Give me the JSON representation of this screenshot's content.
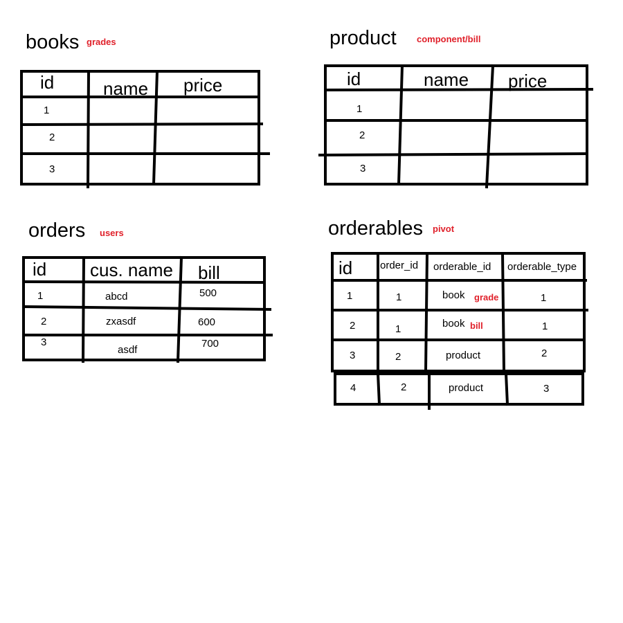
{
  "books": {
    "title": "books",
    "note": "grades",
    "headers": [
      "id",
      "name",
      "price"
    ],
    "rows": [
      [
        "1"
      ],
      [
        "2"
      ],
      [
        "3"
      ]
    ]
  },
  "product": {
    "title": "product",
    "note": "component/bill",
    "headers": [
      "id",
      "name",
      "price"
    ],
    "rows": [
      [
        "1"
      ],
      [
        "2"
      ],
      [
        "3"
      ]
    ]
  },
  "orders": {
    "title": "orders",
    "note": "users",
    "headers": [
      "id",
      "cus. name",
      "bill"
    ],
    "rows": [
      [
        "1",
        "abcd",
        "500"
      ],
      [
        "2",
        "zxasdf",
        "600"
      ],
      [
        "3",
        "asdf",
        "700"
      ]
    ]
  },
  "orderables": {
    "title": "orderables",
    "note": "pivot",
    "headers": [
      "id",
      "order_id",
      "orderable_id",
      "orderable_type"
    ],
    "rows": [
      {
        "id": "1",
        "order_id": "1",
        "orderable_id": "book",
        "tag": "grade",
        "orderable_type": "1"
      },
      {
        "id": "2",
        "order_id": "1",
        "orderable_id": "book",
        "tag": "bill",
        "orderable_type": "1"
      },
      {
        "id": "3",
        "order_id": "2",
        "orderable_id": "product",
        "tag": "",
        "orderable_type": "2"
      },
      {
        "id": "4",
        "order_id": "2",
        "orderable_id": "product",
        "tag": "",
        "orderable_type": "3"
      }
    ]
  }
}
